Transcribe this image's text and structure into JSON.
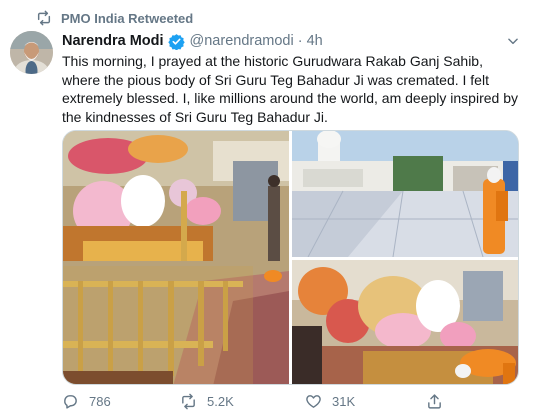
{
  "retweet": {
    "icon": "retweet-icon",
    "text": "PMO India Retweeted"
  },
  "tweet": {
    "author_name": "Narendra Modi",
    "verified_icon": "verified-badge-icon",
    "handle": "@narendramodi",
    "separator": "·",
    "time": "4h",
    "menu_icon": "chevron-down-icon",
    "text": "This morning, I prayed at the historic Gurudwara Rakab Ganj Sahib, where the pious body of Sri Guru Teg Bahadur Ji was cremated. I felt extremely blessed. I, like millions around the world, am deeply inspired by the kindnesses of Sri Guru Teg Bahadur Ji."
  },
  "media": {
    "photos": [
      "gurudwara-interior-photo",
      "gurudwara-courtyard-photo",
      "gurudwara-altar-photo"
    ]
  },
  "actions": {
    "reply": {
      "icon": "reply-icon",
      "count": "786"
    },
    "retweet": {
      "icon": "retweet-icon",
      "count": "5.2K"
    },
    "like": {
      "icon": "heart-icon",
      "count": "31K"
    },
    "share": {
      "icon": "share-icon",
      "count": ""
    }
  },
  "colors": {
    "verified": "#1da1f2",
    "secondary_text": "#657786",
    "text": "#14171a"
  }
}
